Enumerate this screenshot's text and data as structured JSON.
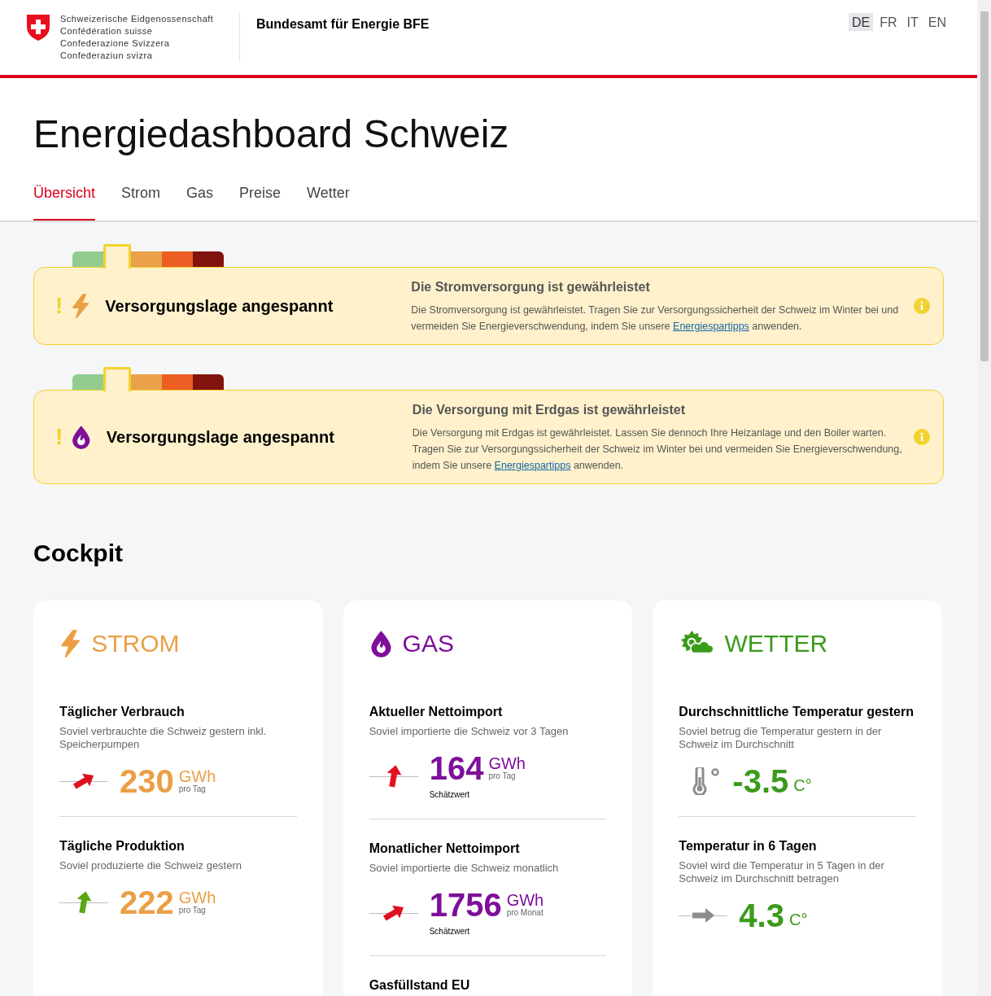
{
  "header": {
    "federal_lines": [
      "Schweizerische Eidgenossenschaft",
      "Confédération suisse",
      "Confederazione Svizzera",
      "Confederaziun svizra"
    ],
    "office": "Bundesamt für Energie BFE",
    "languages": [
      {
        "label": "DE",
        "selected": true
      },
      {
        "label": "FR",
        "selected": false
      },
      {
        "label": "IT",
        "selected": false
      },
      {
        "label": "EN",
        "selected": false
      }
    ]
  },
  "page_title": "Energiedashboard Schweiz",
  "tabs": [
    {
      "label": "Übersicht",
      "selected": true
    },
    {
      "label": "Strom",
      "selected": false
    },
    {
      "label": "Gas",
      "selected": false
    },
    {
      "label": "Preise",
      "selected": false
    },
    {
      "label": "Wetter",
      "selected": false
    }
  ],
  "alerts": [
    {
      "kind": "strom",
      "mark": "!",
      "stages": [
        {
          "color": "#92cc8f",
          "selected": false
        },
        {
          "color": "#f2d22e",
          "selected": true
        },
        {
          "color": "#eba04a",
          "selected": false
        },
        {
          "color": "#ec5e24",
          "selected": false
        },
        {
          "color": "#82140f",
          "selected": false
        }
      ],
      "status": "Versorgungslage angespannt",
      "heading": "Die Stromversorgung ist gewährleistet",
      "text_before": "Die Stromversorgung ist gewährleistet. Tragen Sie zur Versorgungssicherheit der Schweiz im Winter bei und vermeiden Sie Energieverschwendung, indem Sie unsere",
      "link": "Energiespartipps",
      "text_after": "anwenden."
    },
    {
      "kind": "gas",
      "mark": "!",
      "stages": [
        {
          "color": "#92cc8f",
          "selected": false
        },
        {
          "color": "#f2d22e",
          "selected": true
        },
        {
          "color": "#eba04a",
          "selected": false
        },
        {
          "color": "#ec5e24",
          "selected": false
        },
        {
          "color": "#82140f",
          "selected": false
        }
      ],
      "status": "Versorgungslage angespannt",
      "heading": "Die Versorgung mit Erdgas ist gewährleistet",
      "text_before": "Die Versorgung mit Erdgas ist gewährleistet. Lassen Sie dennoch Ihre Heizanlage und den Boiler warten. Tragen Sie zur Versorgungssicherheit der Schweiz im Winter bei und vermeiden Sie Energieverschwendung, indem Sie unsere",
      "link": "Energiespartipps",
      "text_after": "anwenden."
    }
  ],
  "cockpit_title": "Cockpit",
  "cards": [
    {
      "kind": "strom",
      "title": "STROM",
      "color": "#eb9f45",
      "metrics": [
        {
          "title": "Täglicher Verbrauch",
          "description": "Soviel verbrauchte die Schweiz gestern inkl. Speicherpumpen",
          "kind": "up-right",
          "color": "#e0101e",
          "value": "230",
          "unit": "GWh",
          "per": "pro Tag"
        },
        {
          "title": "Tägliche Produktion",
          "description": "Soviel produzierte die Schweiz gestern",
          "kind": "up",
          "color": "#5aa614",
          "value": "222",
          "unit": "GWh",
          "per": "pro Tag"
        }
      ]
    },
    {
      "kind": "gas",
      "title": "GAS",
      "color": "#7d0f99",
      "metrics": [
        {
          "title": "Aktueller Nettoimport",
          "description": "Soviel importierte die Schweiz vor 3 Tagen",
          "kind": "up",
          "color": "#e0101e",
          "value": "164",
          "unit": "GWh",
          "per": "pro Tag",
          "note": "Schätzwert"
        },
        {
          "title": "Monatlicher Nettoimport",
          "description": "Soviel importierte die Schweiz monatlich",
          "kind": "up-right",
          "color": "#e0101e",
          "value": "1756",
          "unit": "GWh",
          "per": "pro Monat",
          "note": "Schätzwert"
        },
        {
          "title": "Gasfüllstand EU",
          "kind": "title-only"
        }
      ]
    },
    {
      "kind": "wetter",
      "title": "WETTER",
      "color": "#3a9a1a",
      "metrics": [
        {
          "title": "Durchschnittliche Temperatur gestern",
          "description": "Soviel betrug die Temperatur gestern in der Schweiz im Durchschnitt",
          "kind": "thermometer",
          "color": "#8c8c8c",
          "value": "-3.5",
          "unit": "C°"
        },
        {
          "title": "Temperatur in 6 Tagen",
          "description": "Soviel wird die Temperatur in 5 Tagen in der Schweiz im Durchschnitt betragen",
          "kind": "right",
          "color": "#8c8c8c",
          "value": "4.3",
          "unit": "C°"
        }
      ]
    }
  ]
}
